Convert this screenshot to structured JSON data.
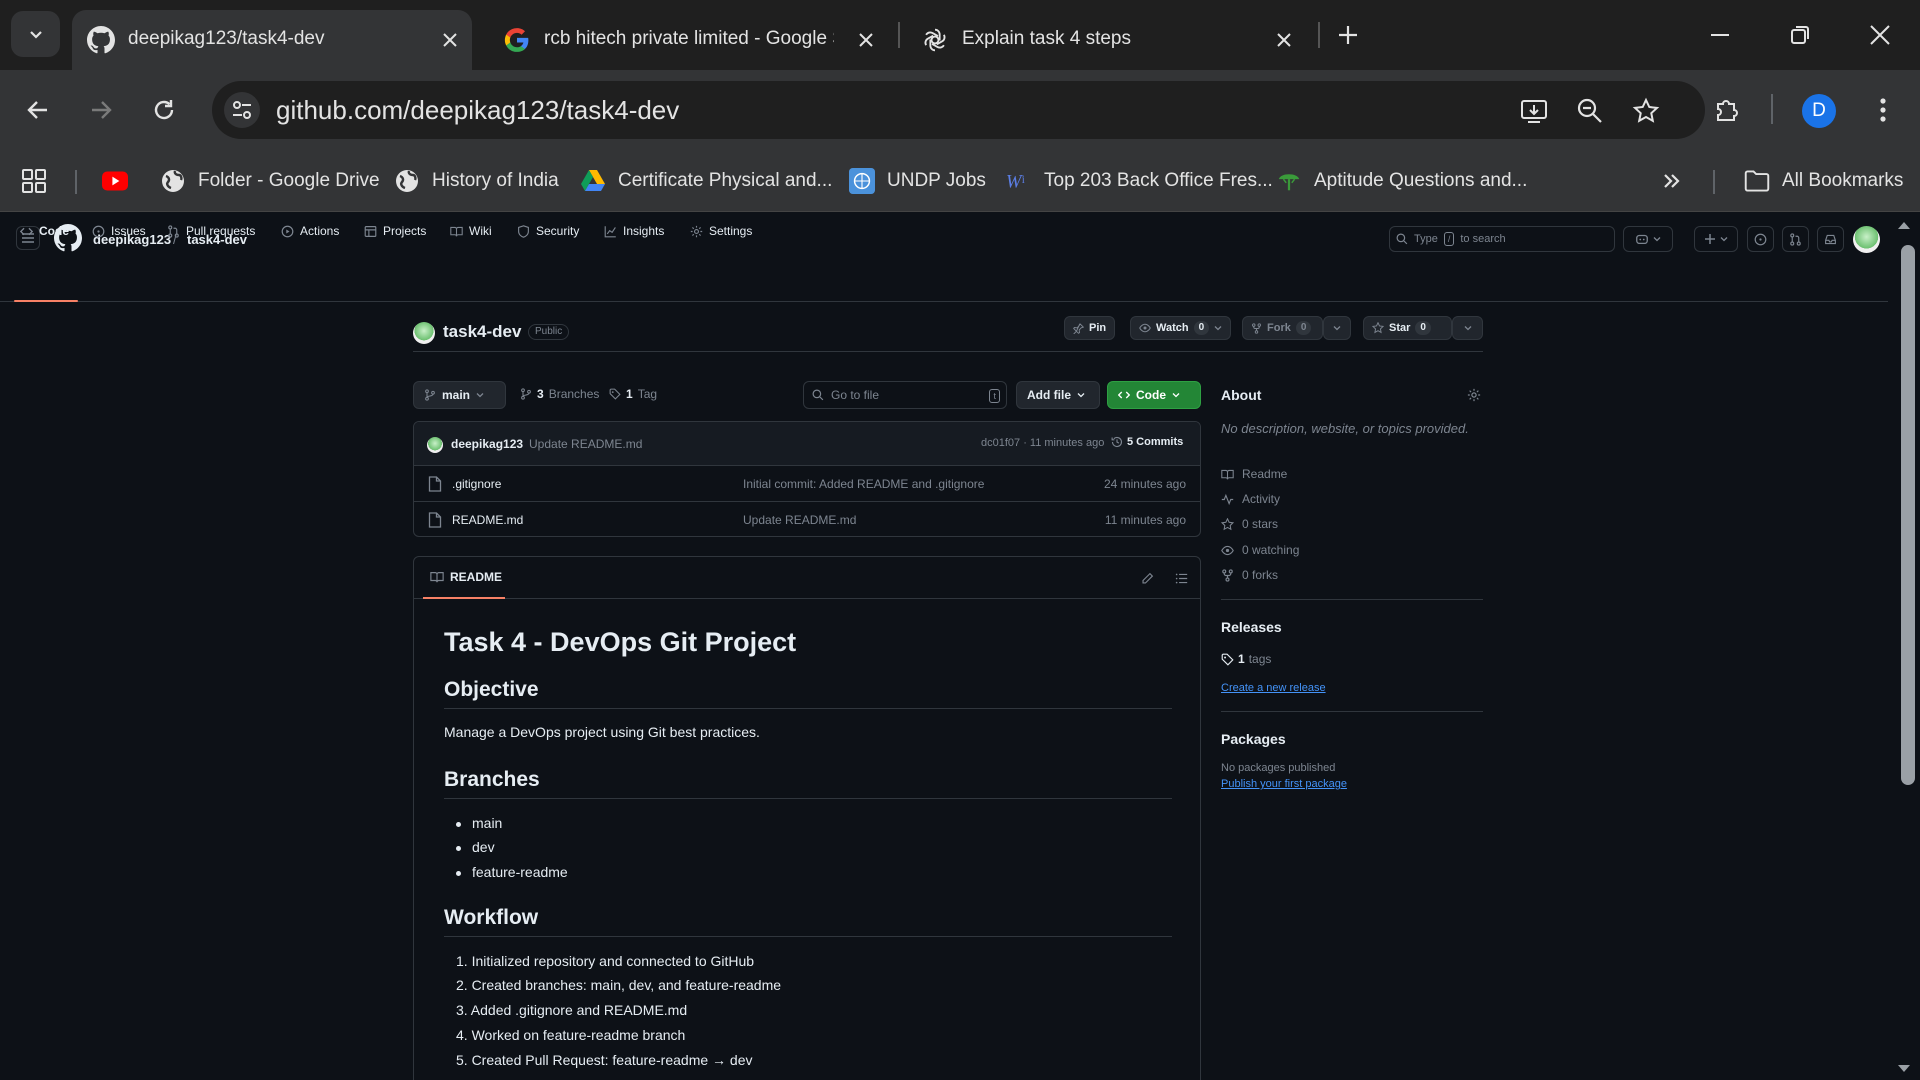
{
  "browser": {
    "tabs": [
      {
        "title": "deepikag123/task4-dev",
        "active": true,
        "icon": "github-icon"
      },
      {
        "title": "rcb hitech private limited - Google Sea",
        "active": false,
        "icon": "google-icon"
      },
      {
        "title": "Explain task 4 steps",
        "active": false,
        "icon": "chatgpt-icon"
      }
    ],
    "url": "github.com/deepikag123/task4-dev",
    "profile_initial": "D",
    "bookmarks": [
      {
        "label": "",
        "icon": "youtube-icon"
      },
      {
        "label": "Folder - Google Drive",
        "icon": "globe-icon"
      },
      {
        "label": "History of India",
        "icon": "globe-icon"
      },
      {
        "label": "Certificate Physical and...",
        "icon": "google-drive-icon"
      },
      {
        "label": "UNDP Jobs",
        "icon": "un-icon"
      },
      {
        "label": "Top 203 Back Office Fres...",
        "icon": "wikipedia-icon"
      },
      {
        "label": "Aptitude Questions and...",
        "icon": "indiabix-icon"
      }
    ],
    "all_bookmarks": "All Bookmarks"
  },
  "github": {
    "owner": "deepikag123",
    "repo": "task4-dev",
    "search_placeholder_pre": "Type",
    "search_key": "/",
    "search_placeholder_post": "to search",
    "repo_nav": [
      "Code",
      "Issues",
      "Pull requests",
      "Actions",
      "Projects",
      "Wiki",
      "Security",
      "Insights",
      "Settings"
    ],
    "visibility": "Public",
    "actions": {
      "pin": "Pin",
      "watch": "Watch",
      "watch_count": "0",
      "fork": "Fork",
      "fork_count": "0",
      "star": "Star",
      "star_count": "0"
    },
    "branch": "main",
    "branches_count": "3",
    "branches_label": "Branches",
    "tags_count": "1",
    "tags_label": "Tag",
    "goto_placeholder": "Go to file",
    "goto_key": "t",
    "add_file": "Add file",
    "code_btn": "Code",
    "latest_commit": {
      "user": "deepikag123",
      "message": "Update README.md",
      "sha_time": "dc01f07 · 11 minutes ago",
      "commits": "5 Commits"
    },
    "files": [
      {
        "name": ".gitignore",
        "message": "Initial commit: Added README and .gitignore",
        "time": "24 minutes ago"
      },
      {
        "name": "README.md",
        "message": "Update README.md",
        "time": "11 minutes ago"
      }
    ],
    "readme_tab": "README",
    "readme": {
      "h1": "Task 4 - DevOps Git Project",
      "objective_h": "Objective",
      "objective_p": "Manage a DevOps project using Git best practices.",
      "branches_h": "Branches",
      "branches": [
        "main",
        "dev",
        "feature-readme"
      ],
      "workflow_h": "Workflow",
      "workflow": [
        "1. Initialized repository and connected to GitHub",
        "2. Created branches: main, dev, and feature-readme",
        "3. Added .gitignore and README.md",
        "4. Worked on feature-readme branch",
        "5. Created Pull Request: feature-readme → dev"
      ]
    },
    "about": {
      "title": "About",
      "desc": "No description, website, or topics provided.",
      "items": [
        "Readme",
        "Activity",
        "0 stars",
        "0 watching",
        "0 forks"
      ]
    },
    "releases": {
      "title": "Releases",
      "tags": "1",
      "tags_label": "tags",
      "create": "Create a new release"
    },
    "packages": {
      "title": "Packages",
      "none": "No packages published",
      "publish": "Publish your first package"
    }
  }
}
